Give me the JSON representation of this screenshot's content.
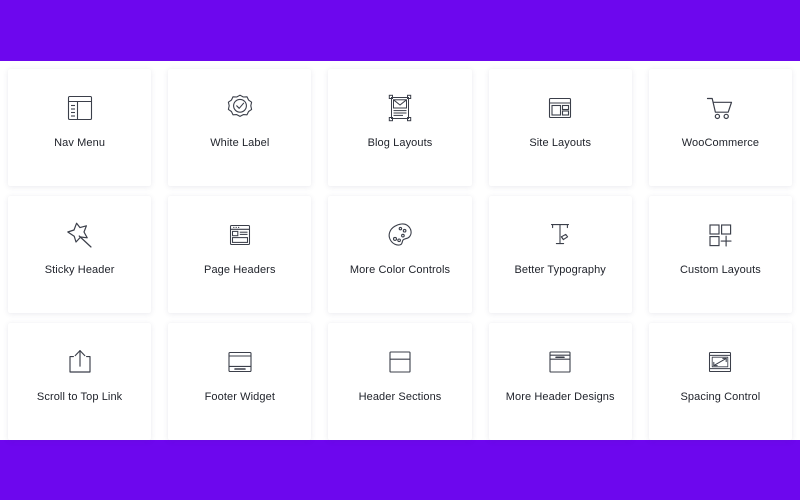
{
  "theme": {
    "banner_color": "#6D07EE",
    "page_background": "#ffffff",
    "card_background": "#ffffff",
    "label_color": "#21242c",
    "icon_color": "#3b3f4a"
  },
  "banners": {
    "top": "",
    "bottom": ""
  },
  "features": [
    {
      "label": "Nav Menu",
      "icon": "nav-menu-icon"
    },
    {
      "label": "White Label",
      "icon": "white-label-badge-icon"
    },
    {
      "label": "Blog Layouts",
      "icon": "blog-layouts-icon"
    },
    {
      "label": "Site Layouts",
      "icon": "site-layouts-icon"
    },
    {
      "label": "WooCommerce",
      "icon": "shopping-cart-icon"
    },
    {
      "label": "Sticky Header",
      "icon": "pushpin-icon"
    },
    {
      "label": "Page Headers",
      "icon": "page-headers-icon"
    },
    {
      "label": "More Color Controls",
      "icon": "color-palette-icon"
    },
    {
      "label": "Better Typography",
      "icon": "typography-t-pen-icon"
    },
    {
      "label": "Custom Layouts",
      "icon": "custom-layouts-grid-plus-icon"
    },
    {
      "label": "Scroll to Top Link",
      "icon": "scroll-to-top-upload-icon"
    },
    {
      "label": "Footer Widget",
      "icon": "footer-widget-icon"
    },
    {
      "label": "Header Sections",
      "icon": "header-sections-icon"
    },
    {
      "label": "More Header Designs",
      "icon": "more-header-designs-icon"
    },
    {
      "label": "Spacing Control",
      "icon": "spacing-control-diagonal-arrow-icon"
    }
  ]
}
